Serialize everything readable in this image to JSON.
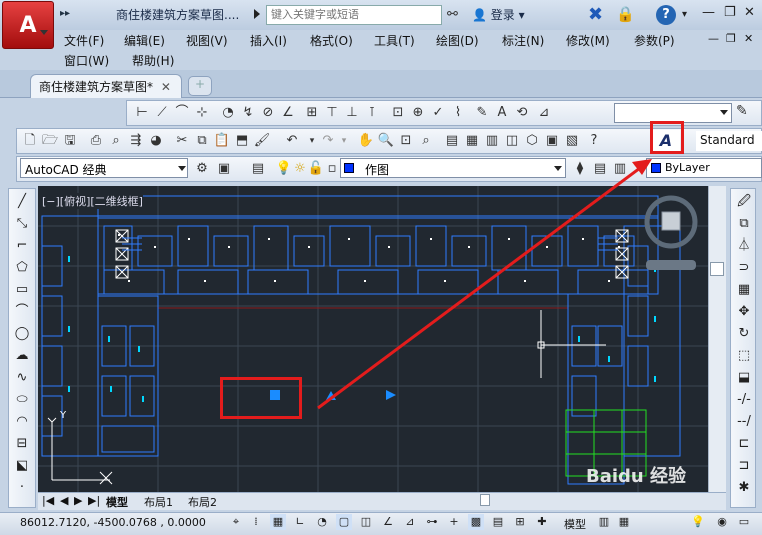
{
  "title_bar": {
    "title": "商住楼建筑方案草图....",
    "search_placeholder": "键入关键字或短语",
    "login": "登录",
    "logo_letter": "A",
    "quick_access": "▸▸",
    "help": "?"
  },
  "window_buttons": {
    "minimize": "—",
    "restore": "❐",
    "close": "✕"
  },
  "menu": {
    "row1": [
      "文件(F)",
      "编辑(E)",
      "视图(V)",
      "插入(I)",
      "格式(O)",
      "工具(T)",
      "绘图(D)",
      "标注(N)",
      "修改(M)",
      "参数(P)"
    ],
    "row2": [
      "窗口(W)",
      "帮助(H)"
    ],
    "doc_controls": {
      "minimize": "—",
      "restore": "❐",
      "close": "✕"
    }
  },
  "tabs": {
    "document": "商住楼建筑方案草图*",
    "close": "✕",
    "new": "+"
  },
  "toolbars": {
    "text_style": "Standard",
    "workspace": "AutoCAD 经典",
    "layer": "作图",
    "color": "ByLayer"
  },
  "viewport": {
    "label": "[−][俯视][二维线框]",
    "ucs_x": "X",
    "ucs_y": "Y"
  },
  "layout_tabs": [
    "模型",
    "布局1",
    "布局2"
  ],
  "status": {
    "coords": "86012.7120, -4500.0768 , 0.0000",
    "model": "模型"
  },
  "watermark": "Baidu 经验",
  "colors": {
    "highlight": "#e31c1c",
    "canvas": "#212830",
    "building": "#2f7dff",
    "accent_green": "#22e022"
  }
}
